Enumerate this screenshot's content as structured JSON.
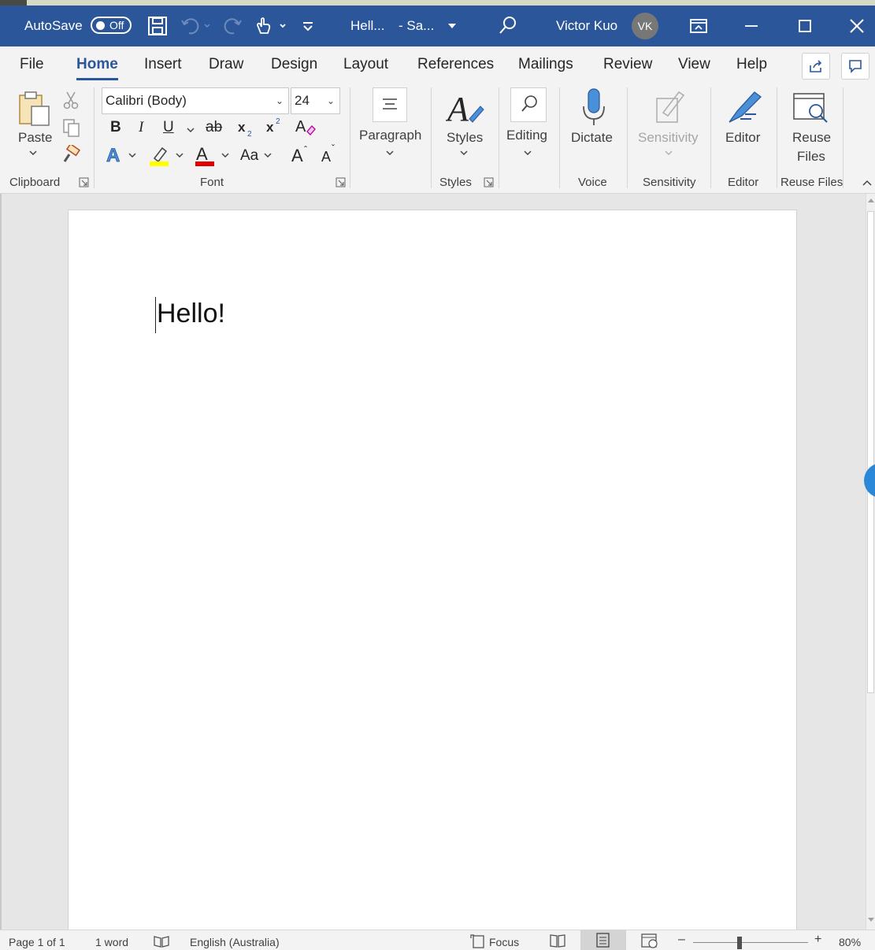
{
  "titlebar": {
    "autosave_label": "AutoSave",
    "autosave_state": "Off",
    "doc_title": "Hell...",
    "save_status": "- Sa...",
    "user_name": "Victor Kuo",
    "user_initials": "VK",
    "accent_color": "#2b579a"
  },
  "menu_tabs": [
    "File",
    "Home",
    "Insert",
    "Draw",
    "Design",
    "Layout",
    "References",
    "Mailings",
    "Review",
    "View",
    "Help"
  ],
  "active_tab": "Home",
  "ribbon": {
    "clipboard": {
      "paste_label": "Paste",
      "group_label": "Clipboard"
    },
    "font": {
      "font_name": "Calibri (Body)",
      "font_size": "24",
      "group_label": "Font",
      "bold": "B",
      "italic": "I",
      "underline": "U",
      "strikethrough": "ab",
      "change_case": "Aa",
      "grow_font": "A",
      "shrink_font": "A"
    },
    "paragraph": {
      "label": "Paragraph"
    },
    "styles": {
      "label": "Styles",
      "group_label": "Styles"
    },
    "editing": {
      "label": "Editing"
    },
    "voice": {
      "dictate_label": "Dictate",
      "group_label": "Voice"
    },
    "sensitivity": {
      "label": "Sensitivity",
      "group_label": "Sensitivity"
    },
    "editor": {
      "label": "Editor",
      "group_label": "Editor"
    },
    "reuse_files": {
      "label_line1": "Reuse",
      "label_line2": "Files",
      "group_label": "Reuse Files"
    }
  },
  "document": {
    "text": "Hello!"
  },
  "statusbar": {
    "page": "Page 1 of 1",
    "words": "1 word",
    "language": "English (Australia)",
    "focus": "Focus",
    "zoom": "80%"
  }
}
